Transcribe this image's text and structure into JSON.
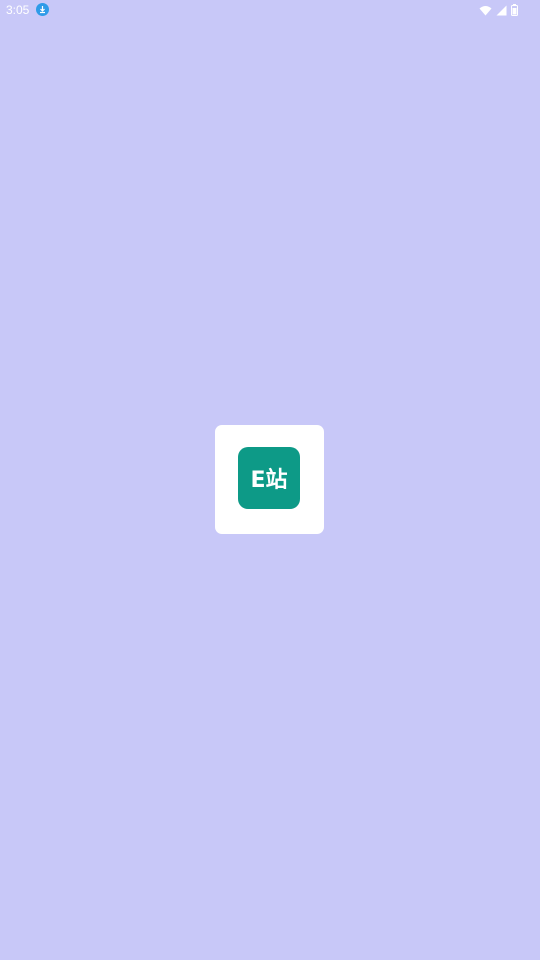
{
  "status_bar": {
    "time": "3:05",
    "icons": [
      "download-icon",
      "wifi-icon",
      "signal-icon",
      "battery-icon"
    ]
  },
  "splash": {
    "logo_text": "E站",
    "colors": {
      "background": "#c8c8f8",
      "card": "#ffffff",
      "logo": "#0d9a87"
    }
  }
}
